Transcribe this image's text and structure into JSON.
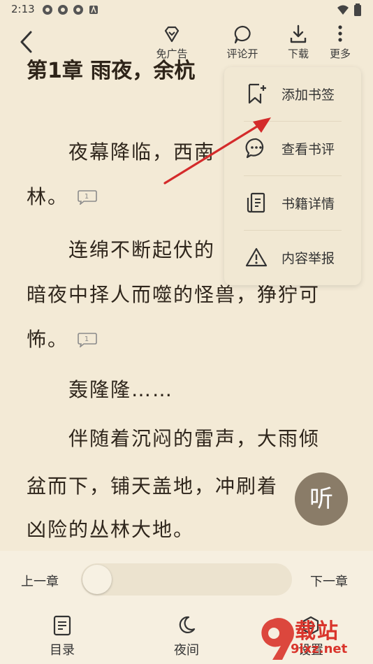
{
  "status_bar": {
    "time": "2:13"
  },
  "toolbar": {
    "no_ads": "免广告",
    "comments_on": "评论开",
    "download": "下载",
    "more": "更多"
  },
  "content": {
    "chapter_title": "第1章 雨夜，余杭",
    "lines": [
      "夜幕降临，西南",
      "林。",
      "连绵不断起伏的",
      "暗夜中择人而噬的怪兽，狰狞可",
      "怖。",
      "轰隆隆……",
      "伴随着沉闷的雷声，大雨倾",
      "盆而下，铺天盖地，冲刷着",
      "凶险的丛林大地。"
    ],
    "comment_count": "1"
  },
  "menu": {
    "items": [
      {
        "label": "添加书签",
        "icon": "bookmark-add-icon"
      },
      {
        "label": "查看书评",
        "icon": "chat-dots-icon"
      },
      {
        "label": "书籍详情",
        "icon": "book-details-icon"
      },
      {
        "label": "内容举报",
        "icon": "warning-icon"
      }
    ]
  },
  "listen": {
    "label": "听"
  },
  "chapter_nav": {
    "prev": "上一章",
    "next": "下一章",
    "progress": 0
  },
  "bottom_nav": {
    "toc": "目录",
    "night": "夜间",
    "settings": "设置"
  },
  "watermark": {
    "brand": "载站",
    "domain": "9ixz.net"
  },
  "colors": {
    "background": "#f3ead6",
    "arrow": "#d42b2b",
    "listen_bubble": "#8a7c68"
  }
}
